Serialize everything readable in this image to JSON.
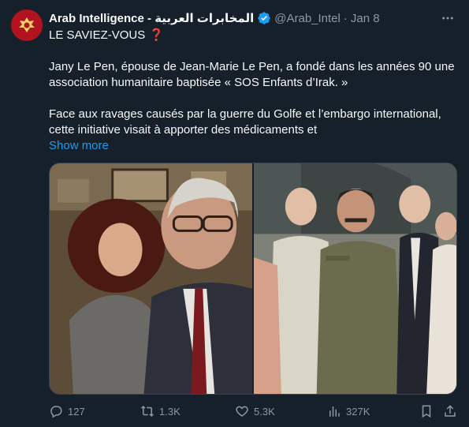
{
  "author": {
    "display_name": "Arab Intelligence - المخابرات العربية",
    "handle": "@Arab_Intel",
    "separator": "·",
    "date": "Jan 8"
  },
  "body": {
    "headline": "LE SAVIEZ-VOUS",
    "headline_emoji": "❓",
    "para1": "Jany Le Pen, épouse de Jean-Marie Le Pen, a fondé dans les années 90 une association humanitaire baptisée « SOS Enfants d’Irak. »",
    "para2": "Face aux ravages causés par la guerre du Golfe et l’embargo international, cette initiative visait à apporter des médicaments et",
    "show_more": "Show more"
  },
  "stats": {
    "replies": "127",
    "reposts": "1.3K",
    "likes": "5.3K",
    "views": "327K"
  },
  "icons": {
    "avatar": "intelligence-emblem-icon",
    "verified": "verified-badge-icon",
    "more": "more-options-icon",
    "reply": "reply-icon",
    "repost": "repost-icon",
    "like": "heart-icon",
    "views": "views-chart-icon",
    "bookmark": "bookmark-icon",
    "share": "share-icon"
  },
  "colors": {
    "background": "#15202b",
    "text": "#f7f9f9",
    "muted": "#8b98a5",
    "link": "#1d9bf0",
    "verified": "#1d9bf0",
    "question_mark": "#e0245e"
  }
}
